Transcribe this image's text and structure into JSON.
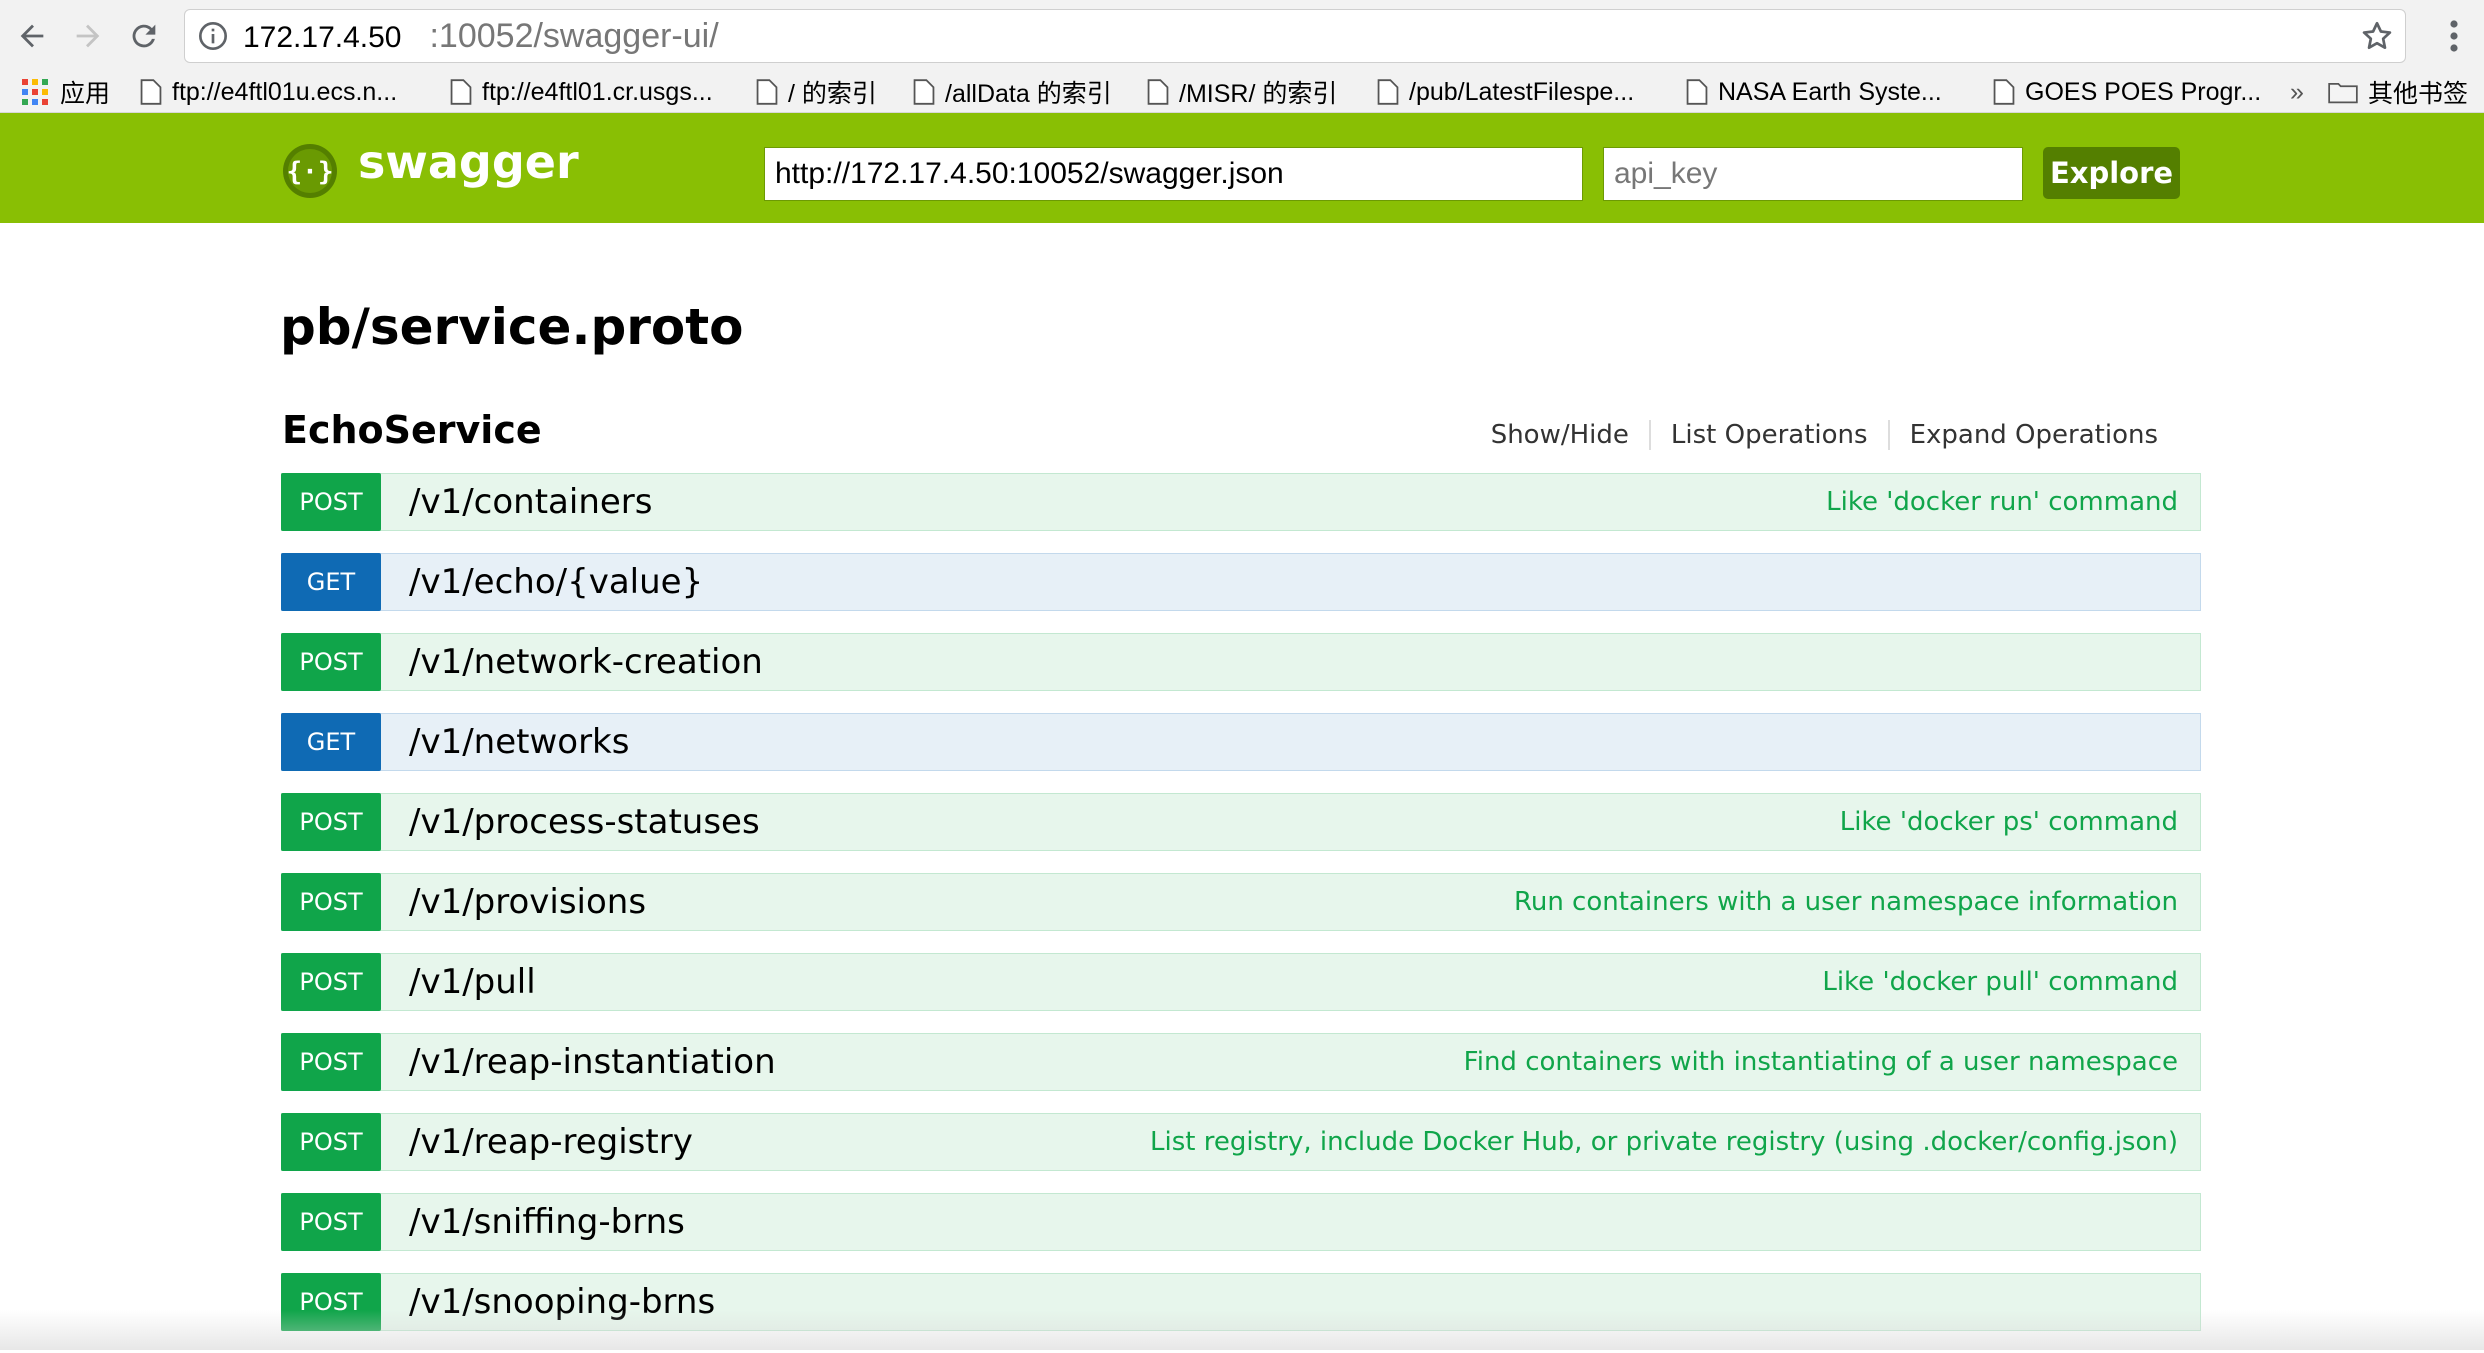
{
  "browser": {
    "url_host": "172.17.4.50",
    "url_path": ":10052/swagger-ui/",
    "bookmarks": [
      {
        "label": "应用",
        "icon": "apps-grid-icon"
      },
      {
        "label": "ftp://e4ftl01u.ecs.n...",
        "icon": "page-icon"
      },
      {
        "label": "ftp://e4ftl01.cr.usgs...",
        "icon": "page-icon"
      },
      {
        "label": "/ 的索引",
        "icon": "page-icon"
      },
      {
        "label": "/allData 的索引",
        "icon": "page-icon"
      },
      {
        "label": "/MISR/ 的索引",
        "icon": "page-icon"
      },
      {
        "label": "/pub/LatestFilespe...",
        "icon": "page-icon"
      },
      {
        "label": "NASA Earth Syste...",
        "icon": "page-icon"
      },
      {
        "label": "GOES POES Progr...",
        "icon": "page-icon"
      },
      {
        "label": "»",
        "icon": "overflow-chevron"
      },
      {
        "label": "其他书签",
        "icon": "folder-icon"
      }
    ]
  },
  "header": {
    "brand": "swagger",
    "spec_url": "http://172.17.4.50:10052/swagger.json",
    "api_key_placeholder": "api_key",
    "explore_label": "Explore",
    "brand_color": "#89bf04"
  },
  "page_title": "pb/service.proto",
  "resource": {
    "name": "EchoService",
    "links": [
      "Show/Hide",
      "List Operations",
      "Expand Operations"
    ]
  },
  "operations": [
    {
      "method": "POST",
      "path": "/v1/containers",
      "summary": "Like 'docker run' command"
    },
    {
      "method": "GET",
      "path": "/v1/echo/{value}",
      "summary": ""
    },
    {
      "method": "POST",
      "path": "/v1/network-creation",
      "summary": ""
    },
    {
      "method": "GET",
      "path": "/v1/networks",
      "summary": ""
    },
    {
      "method": "POST",
      "path": "/v1/process-statuses",
      "summary": "Like 'docker ps' command"
    },
    {
      "method": "POST",
      "path": "/v1/provisions",
      "summary": "Run containers with a user namespace information"
    },
    {
      "method": "POST",
      "path": "/v1/pull",
      "summary": "Like 'docker pull' command"
    },
    {
      "method": "POST",
      "path": "/v1/reap-instantiation",
      "summary": "Find containers with instantiating of a user namespace"
    },
    {
      "method": "POST",
      "path": "/v1/reap-registry",
      "summary": "List registry, include Docker Hub, or private registry (using .docker/config.json)"
    },
    {
      "method": "POST",
      "path": "/v1/sniffing-brns",
      "summary": ""
    },
    {
      "method": "POST",
      "path": "/v1/snooping-brns",
      "summary": ""
    }
  ],
  "colors": {
    "post": "#10a54a",
    "get": "#0f6ab4"
  }
}
